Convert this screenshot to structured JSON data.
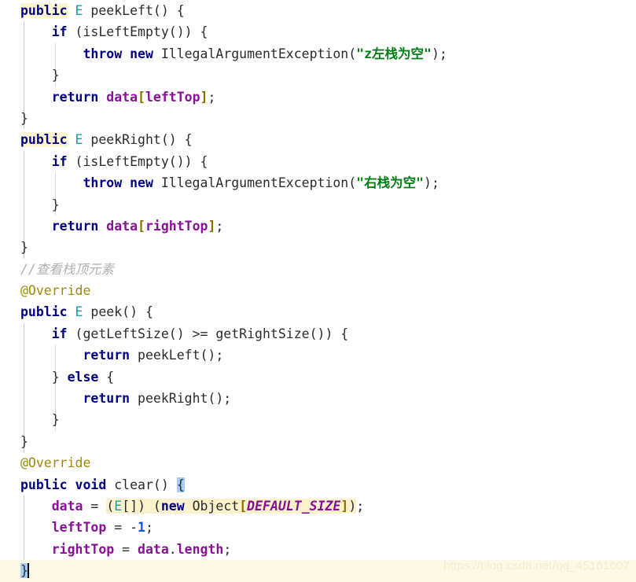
{
  "editor": {
    "language": "java",
    "background_color": "#ffffff",
    "current_line_color": "#fdf9e8",
    "caret_line_number": 27,
    "colors": {
      "keyword": "#000080",
      "generic_type": "#20999d",
      "field": "#871094",
      "string": "#067d17",
      "number": "#1750eb",
      "bracket": "#8a6d00",
      "annotation": "#9e880d",
      "comment": "#b0b0b0",
      "identifier_highlight": "#fdf4d2",
      "cast_highlight": "#fbf1cb",
      "brace_match_highlight": "#a8cdf5"
    },
    "lines": [
      {
        "n": 1,
        "tokens": [
          {
            "t": "public",
            "c": "kw",
            "hl": "ident"
          },
          {
            "t": " ",
            "c": "id"
          },
          {
            "t": "E",
            "c": "type"
          },
          {
            "t": " peekLeft() {",
            "c": "id"
          }
        ]
      },
      {
        "n": 2,
        "tokens": [
          {
            "t": "    ",
            "c": "id"
          },
          {
            "t": "if",
            "c": "kw"
          },
          {
            "t": " (isLeftEmpty()) {",
            "c": "id"
          }
        ]
      },
      {
        "n": 3,
        "tokens": [
          {
            "t": "        ",
            "c": "id"
          },
          {
            "t": "throw new",
            "c": "kw"
          },
          {
            "t": " IllegalArgumentException(",
            "c": "id"
          },
          {
            "t": "\"z左栈为空\"",
            "c": "str"
          },
          {
            "t": ");",
            "c": "id"
          }
        ]
      },
      {
        "n": 4,
        "tokens": [
          {
            "t": "    }",
            "c": "id"
          }
        ]
      },
      {
        "n": 5,
        "tokens": [
          {
            "t": "    ",
            "c": "id"
          },
          {
            "t": "return",
            "c": "kw"
          },
          {
            "t": " ",
            "c": "id"
          },
          {
            "t": "data",
            "c": "fld"
          },
          {
            "t": "[",
            "c": "brk"
          },
          {
            "t": "leftTop",
            "c": "fld"
          },
          {
            "t": "]",
            "c": "brk"
          },
          {
            "t": ";",
            "c": "id"
          }
        ]
      },
      {
        "n": 6,
        "tokens": [
          {
            "t": "}",
            "c": "id"
          }
        ]
      },
      {
        "n": 7,
        "tokens": [
          {
            "t": "public",
            "c": "kw",
            "hl": "ident"
          },
          {
            "t": " ",
            "c": "id"
          },
          {
            "t": "E",
            "c": "type"
          },
          {
            "t": " peekRight() {",
            "c": "id"
          }
        ]
      },
      {
        "n": 8,
        "tokens": [
          {
            "t": "    ",
            "c": "id"
          },
          {
            "t": "if",
            "c": "kw"
          },
          {
            "t": " (isLeftEmpty()) {",
            "c": "id"
          }
        ]
      },
      {
        "n": 9,
        "tokens": [
          {
            "t": "        ",
            "c": "id"
          },
          {
            "t": "throw new",
            "c": "kw"
          },
          {
            "t": " IllegalArgumentException(",
            "c": "id"
          },
          {
            "t": "\"右栈为空\"",
            "c": "str"
          },
          {
            "t": ");",
            "c": "id"
          }
        ]
      },
      {
        "n": 10,
        "tokens": [
          {
            "t": "    }",
            "c": "id"
          }
        ]
      },
      {
        "n": 11,
        "tokens": [
          {
            "t": "    ",
            "c": "id"
          },
          {
            "t": "return",
            "c": "kw"
          },
          {
            "t": " ",
            "c": "id"
          },
          {
            "t": "data",
            "c": "fld"
          },
          {
            "t": "[",
            "c": "brk"
          },
          {
            "t": "rightTop",
            "c": "fld"
          },
          {
            "t": "]",
            "c": "brk"
          },
          {
            "t": ";",
            "c": "id"
          }
        ]
      },
      {
        "n": 12,
        "tokens": [
          {
            "t": "}",
            "c": "id"
          }
        ]
      },
      {
        "n": 13,
        "tokens": [
          {
            "t": "//查看栈顶元素",
            "c": "cmt"
          }
        ]
      },
      {
        "n": 14,
        "tokens": [
          {
            "t": "@Override",
            "c": "anno"
          }
        ]
      },
      {
        "n": 15,
        "tokens": [
          {
            "t": "public",
            "c": "kw"
          },
          {
            "t": " ",
            "c": "id"
          },
          {
            "t": "E",
            "c": "type"
          },
          {
            "t": " peek() {",
            "c": "id"
          }
        ]
      },
      {
        "n": 16,
        "tokens": [
          {
            "t": "    ",
            "c": "id"
          },
          {
            "t": "if",
            "c": "kw"
          },
          {
            "t": " (getLeftSize() >= getRightSize()) {",
            "c": "id"
          }
        ]
      },
      {
        "n": 17,
        "tokens": [
          {
            "t": "        ",
            "c": "id"
          },
          {
            "t": "return",
            "c": "kw"
          },
          {
            "t": " peekLeft();",
            "c": "id"
          }
        ]
      },
      {
        "n": 18,
        "tokens": [
          {
            "t": "    } ",
            "c": "id"
          },
          {
            "t": "else",
            "c": "kw"
          },
          {
            "t": " {",
            "c": "id"
          }
        ]
      },
      {
        "n": 19,
        "tokens": [
          {
            "t": "        ",
            "c": "id"
          },
          {
            "t": "return",
            "c": "kw"
          },
          {
            "t": " peekRight();",
            "c": "id"
          }
        ]
      },
      {
        "n": 20,
        "tokens": [
          {
            "t": "    }",
            "c": "id"
          }
        ]
      },
      {
        "n": 21,
        "tokens": [
          {
            "t": "}",
            "c": "id"
          }
        ]
      },
      {
        "n": 22,
        "tokens": [
          {
            "t": "@Override",
            "c": "anno"
          }
        ]
      },
      {
        "n": 23,
        "tokens": [
          {
            "t": "public void",
            "c": "kw"
          },
          {
            "t": " clear() ",
            "c": "id"
          },
          {
            "t": "{",
            "c": "id",
            "hl": "brace"
          }
        ]
      },
      {
        "n": 24,
        "tokens": [
          {
            "t": "    ",
            "c": "id"
          },
          {
            "t": "data",
            "c": "fld"
          },
          {
            "t": " = ",
            "c": "id"
          },
          {
            "t": "(",
            "c": "id",
            "hl": "cast"
          },
          {
            "t": "E",
            "c": "type",
            "hl": "cast"
          },
          {
            "t": "[]",
            "c": "id",
            "hl": "cast"
          },
          {
            "t": ") (",
            "c": "id",
            "hl": "cast"
          },
          {
            "t": "new",
            "c": "kw",
            "hl": "cast"
          },
          {
            "t": " Object",
            "c": "id",
            "hl": "cast"
          },
          {
            "t": "[",
            "c": "brk",
            "hl": "cast"
          },
          {
            "t": "DEFAULT_SIZE",
            "c": "fldi",
            "hl": "cast"
          },
          {
            "t": "]",
            "c": "brk",
            "hl": "cast"
          },
          {
            "t": ")",
            "c": "id",
            "hl": "cast"
          },
          {
            "t": ";",
            "c": "id"
          }
        ]
      },
      {
        "n": 25,
        "tokens": [
          {
            "t": "    ",
            "c": "id"
          },
          {
            "t": "leftTop",
            "c": "fld"
          },
          {
            "t": " = -",
            "c": "id"
          },
          {
            "t": "1",
            "c": "num"
          },
          {
            "t": ";",
            "c": "id"
          }
        ]
      },
      {
        "n": 26,
        "tokens": [
          {
            "t": "    ",
            "c": "id"
          },
          {
            "t": "rightTop",
            "c": "fld"
          },
          {
            "t": " = ",
            "c": "id"
          },
          {
            "t": "data",
            "c": "fld"
          },
          {
            "t": ".",
            "c": "id"
          },
          {
            "t": "length",
            "c": "fld"
          },
          {
            "t": ";",
            "c": "id"
          }
        ]
      },
      {
        "n": 27,
        "tokens": [
          {
            "t": "}",
            "c": "id",
            "hl": "brace"
          },
          {
            "t": "",
            "c": "caret"
          }
        ]
      }
    ]
  },
  "watermark": {
    "text": "https://blog.csdn.net/qq_45161607"
  }
}
